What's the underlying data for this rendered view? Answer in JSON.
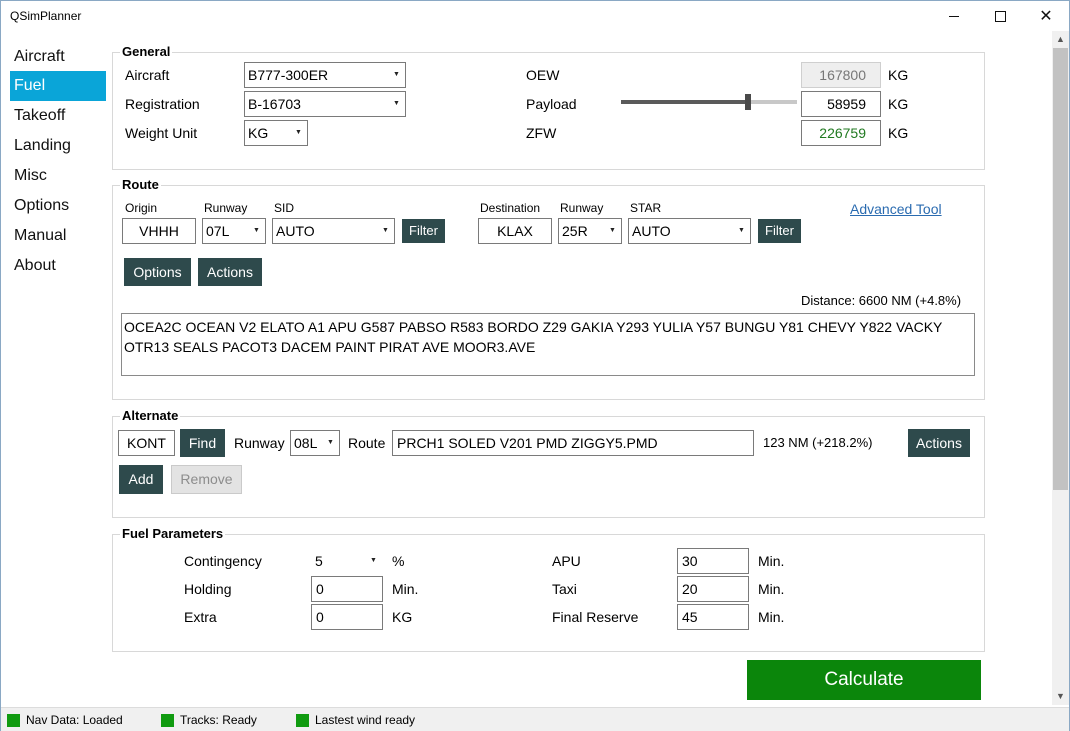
{
  "app": {
    "title": "QSimPlanner"
  },
  "nav": {
    "items": [
      "Aircraft",
      "Fuel",
      "Takeoff",
      "Landing",
      "Misc",
      "Options",
      "Manual",
      "About"
    ],
    "active": "Fuel"
  },
  "general": {
    "title": "General",
    "aircraft_label": "Aircraft",
    "aircraft_value": "B777-300ER",
    "registration_label": "Registration",
    "registration_value": "B-16703",
    "weight_unit_label": "Weight Unit",
    "weight_unit_value": "KG",
    "oew_label": "OEW",
    "oew_value": "167800",
    "oew_unit": "KG",
    "payload_label": "Payload",
    "payload_value": "58959",
    "payload_unit": "KG",
    "payload_fraction": 0.72,
    "zfw_label": "ZFW",
    "zfw_value": "226759",
    "zfw_unit": "KG"
  },
  "route": {
    "title": "Route",
    "origin_label": "Origin",
    "origin_value": "VHHH",
    "orig_runway_label": "Runway",
    "orig_runway_value": "07L",
    "sid_label": "SID",
    "sid_value": "AUTO",
    "filter1_label": "Filter",
    "dest_label": "Destination",
    "dest_value": "KLAX",
    "dest_runway_label": "Runway",
    "dest_runway_value": "25R",
    "star_label": "STAR",
    "star_value": "AUTO",
    "filter2_label": "Filter",
    "advanced_tool_label": "Advanced Tool",
    "options_label": "Options",
    "actions_label": "Actions",
    "distance_text": "Distance: 6600 NM (+4.8%)",
    "route_text": "OCEA2C OCEAN V2 ELATO A1 APU G587 PABSO R583 BORDO Z29 GAKIA Y293 YULIA Y57 BUNGU Y81 CHEVY Y822 VACKY OTR13 SEALS PACOT3 DACEM PAINT PIRAT AVE MOOR3.AVE"
  },
  "alternate": {
    "title": "Alternate",
    "icao_value": "KONT",
    "find_label": "Find",
    "runway_label": "Runway",
    "runway_value": "08L",
    "route_label": "Route",
    "route_value": "PRCH1 SOLED V201 PMD ZIGGY5.PMD",
    "distance_text": "123 NM (+218.2%)",
    "actions_label": "Actions",
    "add_label": "Add",
    "remove_label": "Remove"
  },
  "fuel_params": {
    "title": "Fuel Parameters",
    "contingency_label": "Contingency",
    "contingency_value": "5",
    "contingency_unit": "%",
    "holding_label": "Holding",
    "holding_value": "0",
    "holding_unit": "Min.",
    "extra_label": "Extra",
    "extra_value": "0",
    "extra_unit": "KG",
    "apu_label": "APU",
    "apu_value": "30",
    "apu_unit": "Min.",
    "taxi_label": "Taxi",
    "taxi_value": "20",
    "taxi_unit": "Min.",
    "final_reserve_label": "Final Reserve",
    "final_reserve_value": "45",
    "final_reserve_unit": "Min."
  },
  "calculate_label": "Calculate",
  "status": {
    "nav_data": "Nav Data: Loaded",
    "tracks": "Tracks: Ready",
    "wind": "Lastest wind ready",
    "ok_color": "#109b10"
  },
  "colors": {
    "accent": "#0aa5d8",
    "button": "#2e4a4c",
    "calculate": "#0b860b"
  }
}
